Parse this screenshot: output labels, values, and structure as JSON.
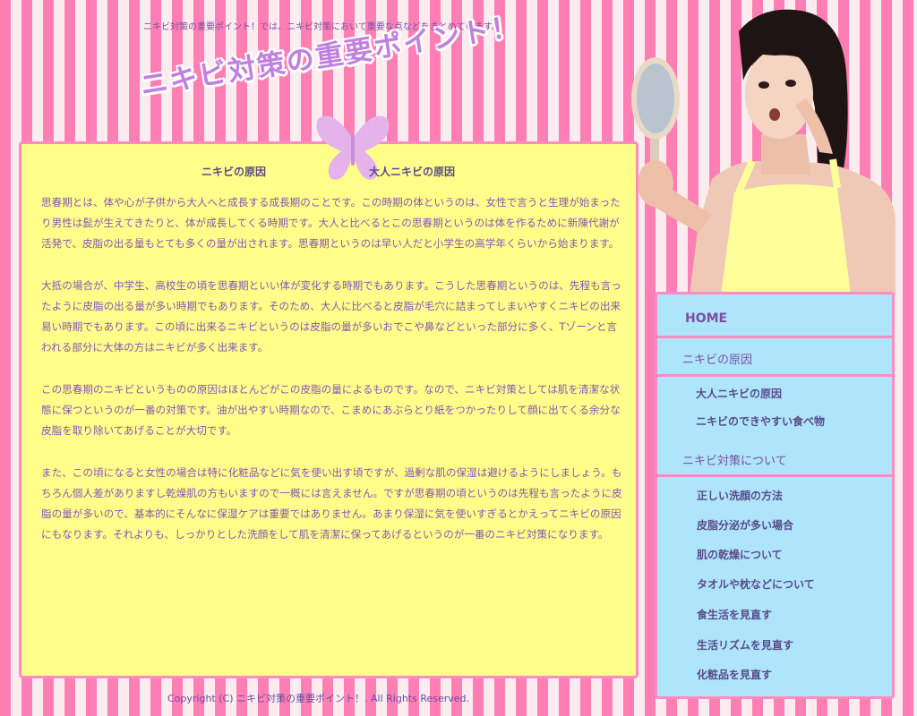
{
  "header": {
    "tagline": "ニキビ対策の重要ポイント！では、ニキビ対策において重要な点などをまとめています。",
    "logo_text": "ニキビ対策の重要ポイント！"
  },
  "main": {
    "tabs": [
      {
        "label": "ニキビの原因"
      },
      {
        "label": "大人ニキビの原因"
      }
    ],
    "paragraphs": [
      "思春期とは、体や心が子供から大人へと成長する成長期のことです。この時期の体というのは、女性で言うと生理が始まったり男性は髭が生えてきたりと、体が成長してくる時期です。大人と比べるとこの思春期というのは体を作るために新陳代謝が活発で、皮脂の出る量もとても多くの量が出されます。思春期というのは早い人だと小学生の高学年くらいから始まります。",
      "大抵の場合が、中学生、高校生の頃を思春期といい体が変化する時期でもあります。こうした思春期というのは、先程も言ったように皮脂の出る量が多い時期でもあります。そのため、大人に比べると皮脂が毛穴に詰まってしまいやすくニキビの出来易い時期でもあります。この頃に出来るニキビというのは皮脂の量が多いおでこや鼻などといった部分に多く、Tゾーンと言われる部分に大体の方はニキビが多く出来ます。",
      "この思春期のニキビというものの原因はほとんどがこの皮脂の量によるものです。なので、ニキビ対策としては肌を清潔な状態に保つというのが一番の対策です。油が出やすい時期なので、こまめにあぶらとり紙をつかったりして顔に出てくる余分な皮脂を取り除いてあげることが大切です。",
      "また、この頃になると女性の場合は特に化粧品などに気を使い出す頃ですが、過剰な肌の保湿は避けるようにしましょう。もちろん個人差がありますし乾燥肌の方もいますので一概には言えません。ですが思春期の頃というのは先程も言ったように皮脂の量が多いので、基本的にそんなに保湿ケアは重要ではありません。あまり保湿に気を使いすぎるとかえってニキビの原因にもなります。それよりも、しっかりとした洗顔をして肌を清潔に保ってあげるというのが一番のニキビ対策になります。"
    ]
  },
  "sidebar": {
    "home": "HOME",
    "section1": "ニキビの原因",
    "section1_items": [
      "大人ニキビの原因",
      "ニキビのできやすい食べ物"
    ],
    "section2": "ニキビ対策について",
    "section2_items": [
      "正しい洗顔の方法",
      "皮脂分泌が多い場合",
      "肌の乾燥について",
      "タオルや枕などについて",
      "食生活を見直す",
      "生活リズムを見直す",
      "化粧品を見直す"
    ]
  },
  "footer": {
    "copyright": "Copyright (C) ニキビ対策の重要ポイント！. All Rights Reserved."
  },
  "colors": {
    "stripe_pink": "#ff7fb4",
    "stripe_light": "#fbecef",
    "main_bg": "#ffff8a",
    "nav_bg": "#aee5fb",
    "border_pink": "#ff8cc0",
    "text_purple": "#8a54b5"
  }
}
